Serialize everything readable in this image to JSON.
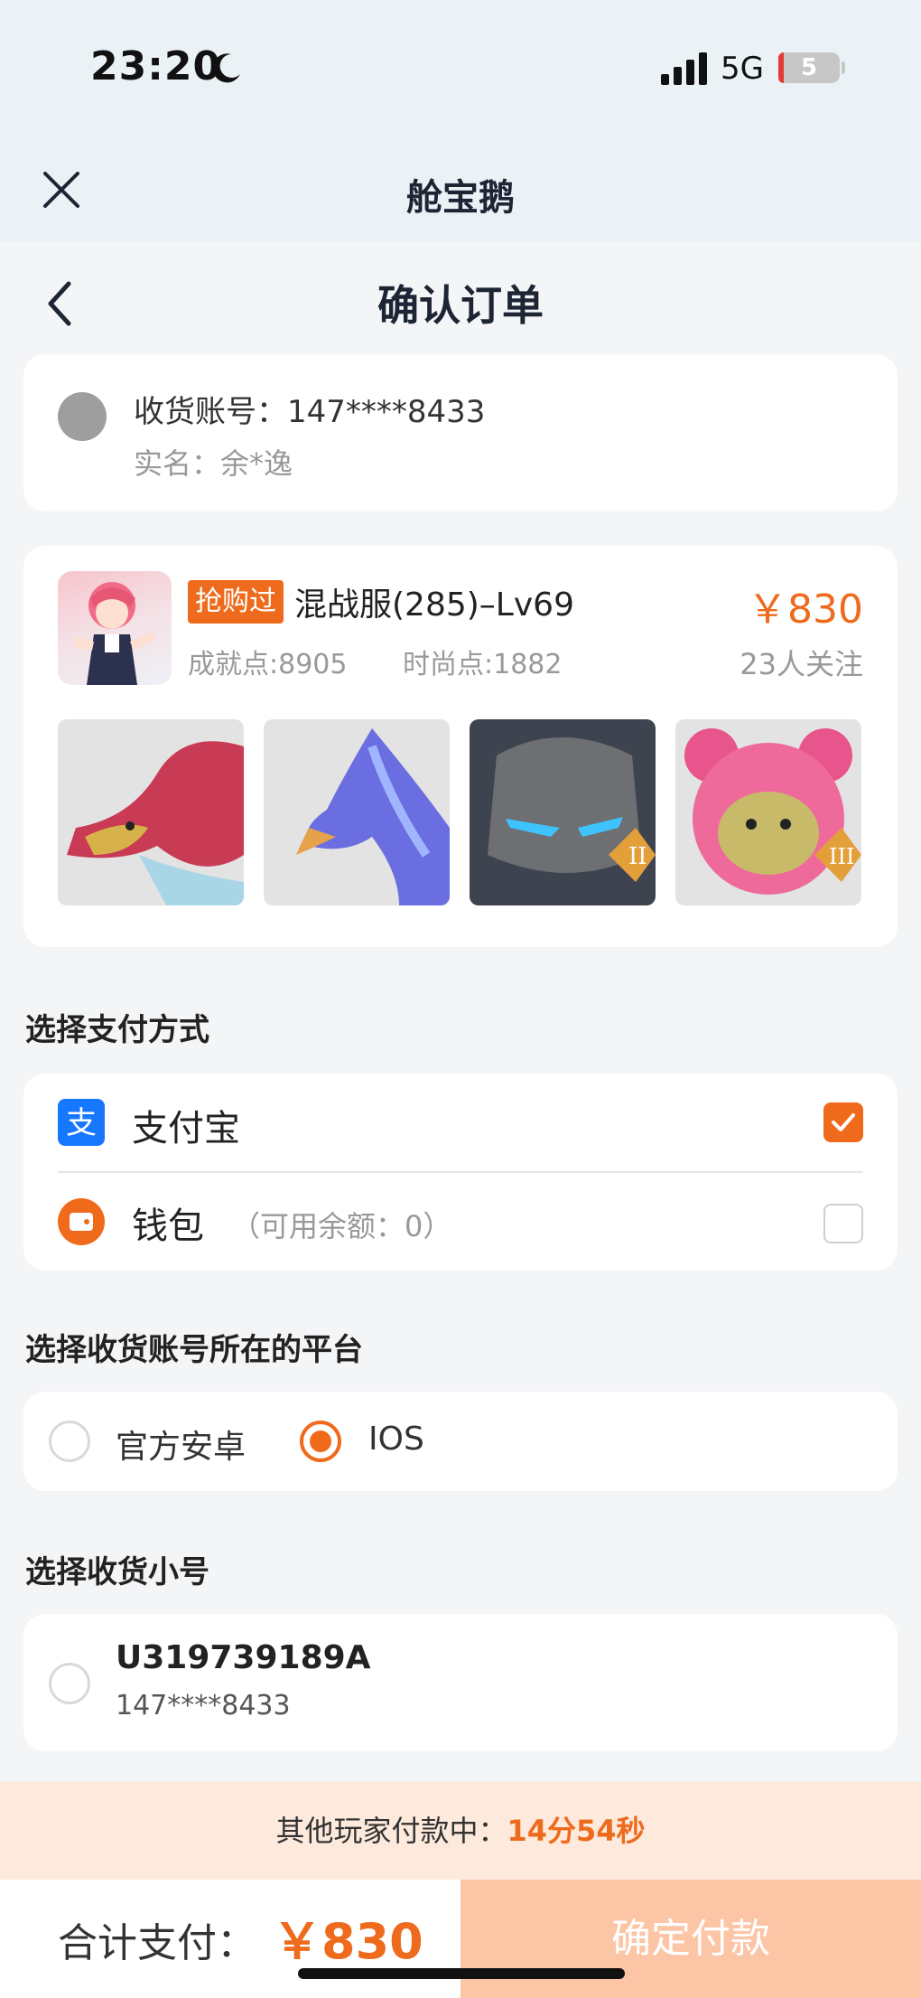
{
  "status": {
    "time": "23:20",
    "network": "5G",
    "battery": "5"
  },
  "app": {
    "title": "舱宝鹅"
  },
  "page": {
    "title": "确认订单"
  },
  "recipient": {
    "account": "收货账号：147****8433",
    "realname": "实名：余*逸"
  },
  "product": {
    "badge": "抢购过",
    "title": "混战服(285)–Lv69",
    "price": "￥830",
    "achievement": "成就点:8905",
    "fashion": "时尚点:1882",
    "followers": "23人关注"
  },
  "payment": {
    "section_title": "选择支付方式",
    "alipay_label": "支付宝",
    "wallet_label": "钱包",
    "wallet_note": "（可用余额：0）"
  },
  "platform": {
    "section_title": "选择收货账号所在的平台",
    "android_label": "官方安卓",
    "ios_label": "IOS"
  },
  "sub_account": {
    "section_title": "选择收货小号",
    "id": "U319739189A",
    "phone": "147****8433"
  },
  "countdown": {
    "prefix": "其他玩家付款中：",
    "time": "14分54秒"
  },
  "footer": {
    "total_label": "合计支付：",
    "total_amount": "￥830",
    "confirm_label": "确定付款"
  },
  "colors": {
    "accent": "#ee6a1c",
    "alipay": "#1677ff",
    "confirm_bg": "#fcc5a5"
  }
}
